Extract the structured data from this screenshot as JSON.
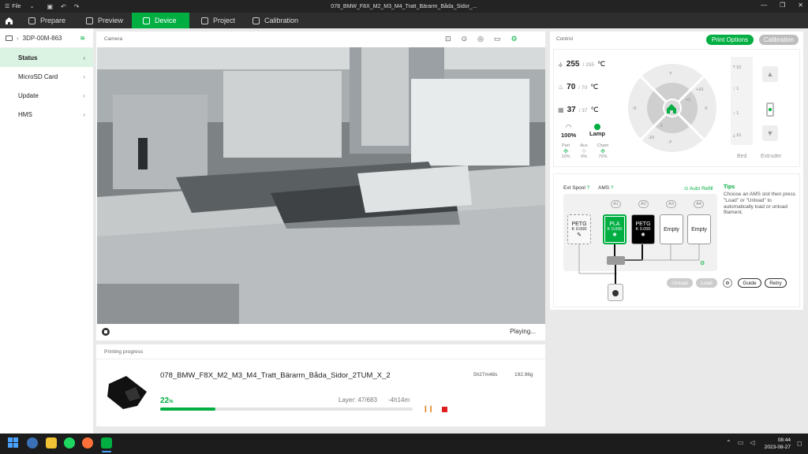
{
  "titlebar": {
    "file_label": "File",
    "window_title": "078_BMW_F8X_M2_M3_M4_Tratt_Bärarm_Båda_Sidor_..."
  },
  "nav": {
    "tabs": [
      {
        "label": "Prepare"
      },
      {
        "label": "Preview"
      },
      {
        "label": "Device"
      },
      {
        "label": "Project"
      },
      {
        "label": "Calibration"
      }
    ],
    "active_tab": "Device"
  },
  "sidebar": {
    "device_name": "3DP-00M-863",
    "items": [
      {
        "label": "Status"
      },
      {
        "label": "MicroSD Card"
      },
      {
        "label": "Update"
      },
      {
        "label": "HMS"
      }
    ]
  },
  "camera": {
    "section_label": "Camera",
    "status": "Playing..."
  },
  "printing": {
    "section_label": "Printing progress",
    "file_name": "078_BMW_F8X_M2_M3_M4_Tratt_Bärarm_Båda_Sidor_2TUM_X_2",
    "print_time": "5h27m48s",
    "weight": "192.96g",
    "percent_label": "22",
    "percent_unit": "%",
    "progress_fraction": 0.22,
    "layer": "Layer: 47/683",
    "remaining": "-4h14m"
  },
  "control": {
    "section_label": "Control",
    "print_options_label": "Print Options",
    "calibration_label": "Calibration",
    "nozzle_temp": "255",
    "nozzle_target": "/ 255",
    "bed_temp": "70",
    "bed_target": "/ 70",
    "chamber_temp": "37",
    "chamber_target": "/ 37",
    "unit": "℃",
    "speed": "100%",
    "lamp_label": "Lamp",
    "fans": {
      "part_label": "Part",
      "part_value": "10%",
      "aux_label": "Aux",
      "aux_value": "0%",
      "cham_label": "Cham",
      "cham_value": "70%"
    },
    "jog": {
      "y_plus": "Y",
      "y_minus": "-Y",
      "x_plus": "X",
      "x_minus": "-X",
      "plus10": "+10",
      "plus1": "+1",
      "minus1": "-1",
      "minus10": "-10"
    },
    "bed_steps": [
      "10",
      "1",
      "1",
      "10"
    ],
    "bed_label": "Bed",
    "extruder_label": "Extruder"
  },
  "ams": {
    "ext_spool_label": "Ext Spool",
    "ams_label": "AMS",
    "help": "?",
    "auto_refill_label": "Auto Refill",
    "ext_slot": {
      "type": "PETG",
      "k": "K 0.000"
    },
    "slot_ids": [
      "A1",
      "A2",
      "A3",
      "A4"
    ],
    "slots": [
      {
        "type": "PLA",
        "k": "K 0.000",
        "color": "#00ae42"
      },
      {
        "type": "PETG",
        "k": "K 0.000",
        "color": "#000000"
      },
      {
        "type": "Empty",
        "k": "",
        "color": "#ffffff"
      },
      {
        "type": "Empty",
        "k": "",
        "color": "#ffffff"
      }
    ],
    "tips_title": "Tips",
    "tips_text": "Choose an AMS slot then press \"Load\" or \"Unload\" to automatically load or unload filament.",
    "unload_label": "Unload",
    "load_label": "Load",
    "guide_label": "Guide",
    "retry_label": "Retry"
  },
  "taskbar": {
    "time": "08:44",
    "date": "2023-08-27"
  },
  "colors": {
    "accent": "#00ae42",
    "dark_bar": "#2e2e2e",
    "pause_icon": "#e08a2c",
    "stop_icon": "#e02020"
  }
}
